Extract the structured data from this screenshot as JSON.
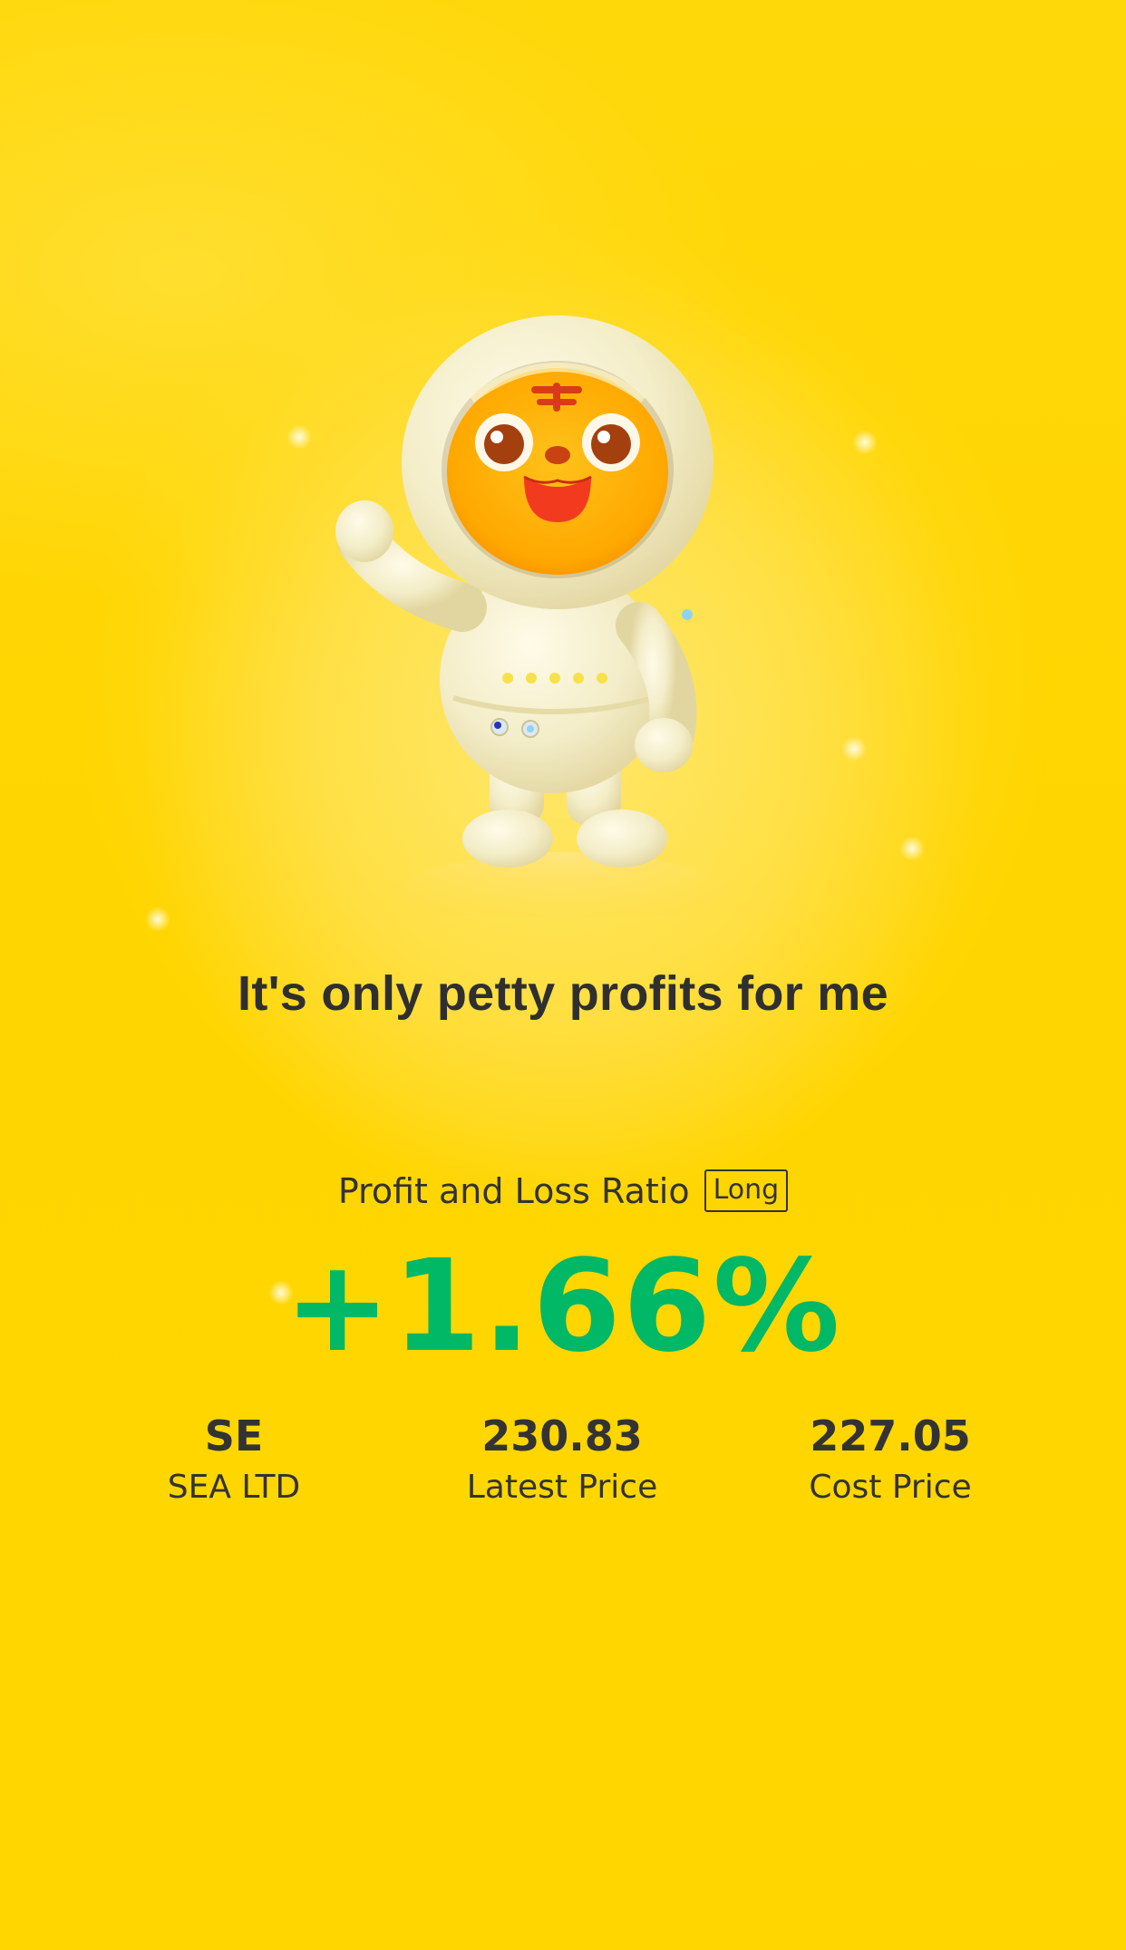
{
  "headline": "It's only petty profits for me",
  "profit_loss": {
    "label": "Profit and Loss Ratio",
    "position_tag": "Long",
    "ratio": "+1.66%"
  },
  "stats": {
    "symbol": "SE",
    "company": "SEA LTD",
    "latest_price": "230.83",
    "latest_price_label": "Latest Price",
    "cost_price": "227.05",
    "cost_price_label": "Cost Price"
  },
  "mascot": {
    "icon": "astronaut-tiger-mascot"
  },
  "colors": {
    "background": "#ffd600",
    "gain": "#00b865",
    "text": "#333333"
  }
}
